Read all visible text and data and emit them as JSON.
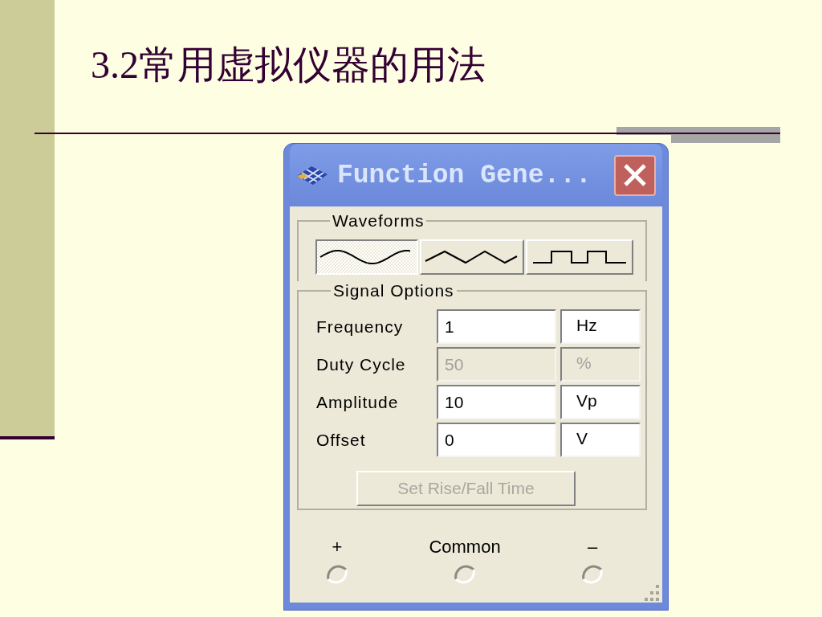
{
  "slide": {
    "title": "3.2常用虚拟仪器的用法"
  },
  "window": {
    "title": "Function Gene..."
  },
  "waveforms": {
    "label": "Waveforms",
    "buttons": [
      {
        "kind": "sine",
        "selected": true
      },
      {
        "kind": "triangle",
        "selected": false
      },
      {
        "kind": "square",
        "selected": false
      }
    ]
  },
  "signal_options": {
    "label": "Signal Options",
    "rows": [
      {
        "label": "Frequency",
        "value": "1",
        "unit": "Hz",
        "disabled": false
      },
      {
        "label": "Duty Cycle",
        "value": "50",
        "unit": "%",
        "disabled": true
      },
      {
        "label": "Amplitude",
        "value": "10",
        "unit": "Vp",
        "disabled": false
      },
      {
        "label": "Offset",
        "value": "0",
        "unit": "V",
        "disabled": false
      }
    ],
    "rise_fall_button": {
      "label": "Set Rise/Fall Time",
      "disabled": true
    }
  },
  "terminals": [
    {
      "label": "+"
    },
    {
      "label": "Common"
    },
    {
      "label": "–"
    }
  ]
}
